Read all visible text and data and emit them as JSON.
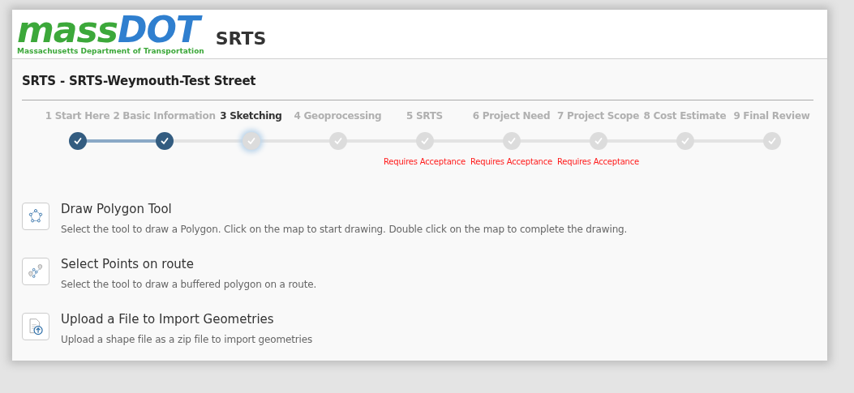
{
  "header": {
    "logo": {
      "word_1": "mass",
      "word_2": "DOT",
      "tagline": "Massachusetts Department of Transportation"
    },
    "app_name": "SRTS"
  },
  "page_title": "SRTS - SRTS-Weymouth-Test Street",
  "steps": [
    {
      "label": "1 Start Here",
      "completed": true,
      "selected": false
    },
    {
      "label": "2 Basic Information",
      "completed": true,
      "selected": false
    },
    {
      "label": "3 Sketching",
      "completed": false,
      "selected": true
    },
    {
      "label": "4 Geoprocessing",
      "completed": false,
      "selected": false
    },
    {
      "label": "5 SRTS",
      "completed": false,
      "selected": false,
      "note": "Requires Acceptance"
    },
    {
      "label": "6 Project Need",
      "completed": false,
      "selected": false,
      "note": "Requires Acceptance"
    },
    {
      "label": "7 Project Scope",
      "completed": false,
      "selected": false,
      "note": "Requires Acceptance"
    },
    {
      "label": "8 Cost Estimate",
      "completed": false,
      "selected": false
    },
    {
      "label": "9 Final Review",
      "completed": false,
      "selected": false
    }
  ],
  "tools": [
    {
      "kind": "polygon",
      "title": "Draw Polygon Tool",
      "description": "Select the tool to draw a Polygon. Click on the map to start drawing. Double click on the map to complete the drawing."
    },
    {
      "kind": "route",
      "title": "Select Points on route",
      "description": "Select the tool to draw a buffered polygon on a route."
    },
    {
      "kind": "upload",
      "title": "Upload a File to Import Geometries",
      "description": "Upload a shape file as a zip file to import geometries"
    }
  ]
}
